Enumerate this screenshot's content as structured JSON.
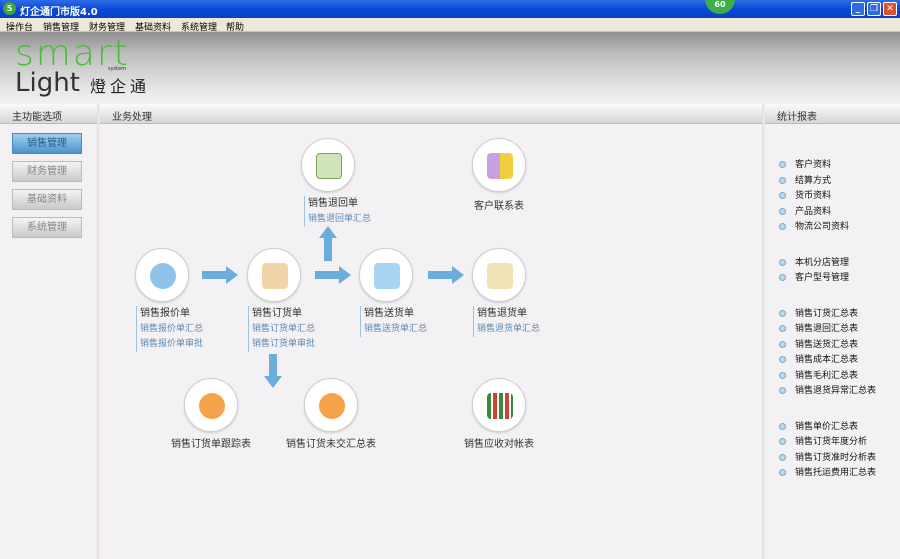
{
  "window": {
    "title": "灯企通门市版4.0",
    "badge": "60",
    "min": "_",
    "max": "❐",
    "close": "✕"
  },
  "menu": [
    "操作台",
    "销售管理",
    "财务管理",
    "基础资料",
    "系统管理",
    "帮助"
  ],
  "logo": {
    "smart": "smart",
    "system": "system",
    "light": "Light",
    "cn": "燈企通"
  },
  "left": {
    "title": "主功能选项",
    "buttons": [
      "销售管理",
      "财务管理",
      "基础资料",
      "系统管理"
    ]
  },
  "main": {
    "title": "业务处理",
    "nodes": [
      {
        "title": "销售退回单",
        "subs": [
          "销售退回单汇总"
        ]
      },
      {
        "title": "客户联系表"
      },
      {
        "title": "销售报价单",
        "subs": [
          "销售报价单汇总",
          "销售报价单审批"
        ]
      },
      {
        "title": "销售订货单",
        "subs": [
          "销售订货单汇总",
          "销售订货单审批"
        ]
      },
      {
        "title": "销售送货单",
        "subs": [
          "销售送货单汇总"
        ]
      },
      {
        "title": "销售退货单",
        "subs": [
          "销售退货单汇总"
        ]
      },
      {
        "title": "销售订货单跟踪表"
      },
      {
        "title": "销售订货未交汇总表"
      },
      {
        "title": "销售应收对帐表"
      }
    ]
  },
  "right": {
    "title": "统计报表",
    "groups": [
      [
        "客户资料",
        "结算方式",
        "货币资料",
        "产品资料",
        "物流公司资料"
      ],
      [
        "本机分店管理",
        "客户型号管理"
      ],
      [
        "销售订货汇总表",
        "销售退回汇总表",
        "销售送货汇总表",
        "销售成本汇总表",
        "销售毛利汇总表",
        "销售退货异常汇总表"
      ],
      [
        "销售单价汇总表",
        "销售订货年度分析",
        "销售订货准时分析表",
        "销售托运费用汇总表"
      ]
    ]
  },
  "colors": {
    "accent": "#6aaedb",
    "title_bar": "#0a49d6"
  }
}
